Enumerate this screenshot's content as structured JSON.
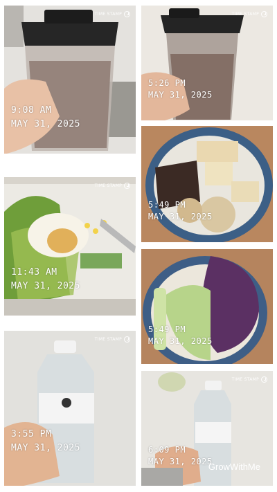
{
  "photos": [
    {
      "time": "9:08 AM",
      "date": "MAY 31, 2025",
      "badge": "TIME STAMP",
      "subject": "chocolate smoothie in blender cup",
      "icon": "time-stamp-icon"
    },
    {
      "time": "5:26 PM",
      "date": "MAY 31, 2025",
      "badge": "TIME STAMP",
      "subject": "chocolate smoothie in blender cup",
      "icon": "time-stamp-icon"
    },
    {
      "time": "5:49 PM",
      "date": "MAY 31, 2025",
      "badge": "",
      "subject": "plate with tofu, beef and garlic mushrooms",
      "icon": ""
    },
    {
      "time": "11:43 AM",
      "date": "MAY 31, 2025",
      "badge": "TIME STAMP",
      "subject": "salad with egg, corn and cucumber",
      "icon": "time-stamp-icon"
    },
    {
      "time": "5:49 PM",
      "date": "MAY 31, 2025",
      "badge": "",
      "subject": "plate with cabbage and red cabbage",
      "icon": ""
    },
    {
      "time": "3:55 PM",
      "date": "MAY 31, 2025",
      "badge": "TIME STAMP",
      "subject": "water bottle in hand",
      "icon": "time-stamp-icon"
    },
    {
      "time": "6:09 PM",
      "date": "MAY 31, 2025",
      "badge": "TIME STAMP",
      "subject": "water bottle in hand",
      "icon": "time-stamp-icon"
    }
  ],
  "watermark": "GrowWithMe",
  "colors": {
    "stamp_text": "#ffffff",
    "background": "#ffffff"
  }
}
